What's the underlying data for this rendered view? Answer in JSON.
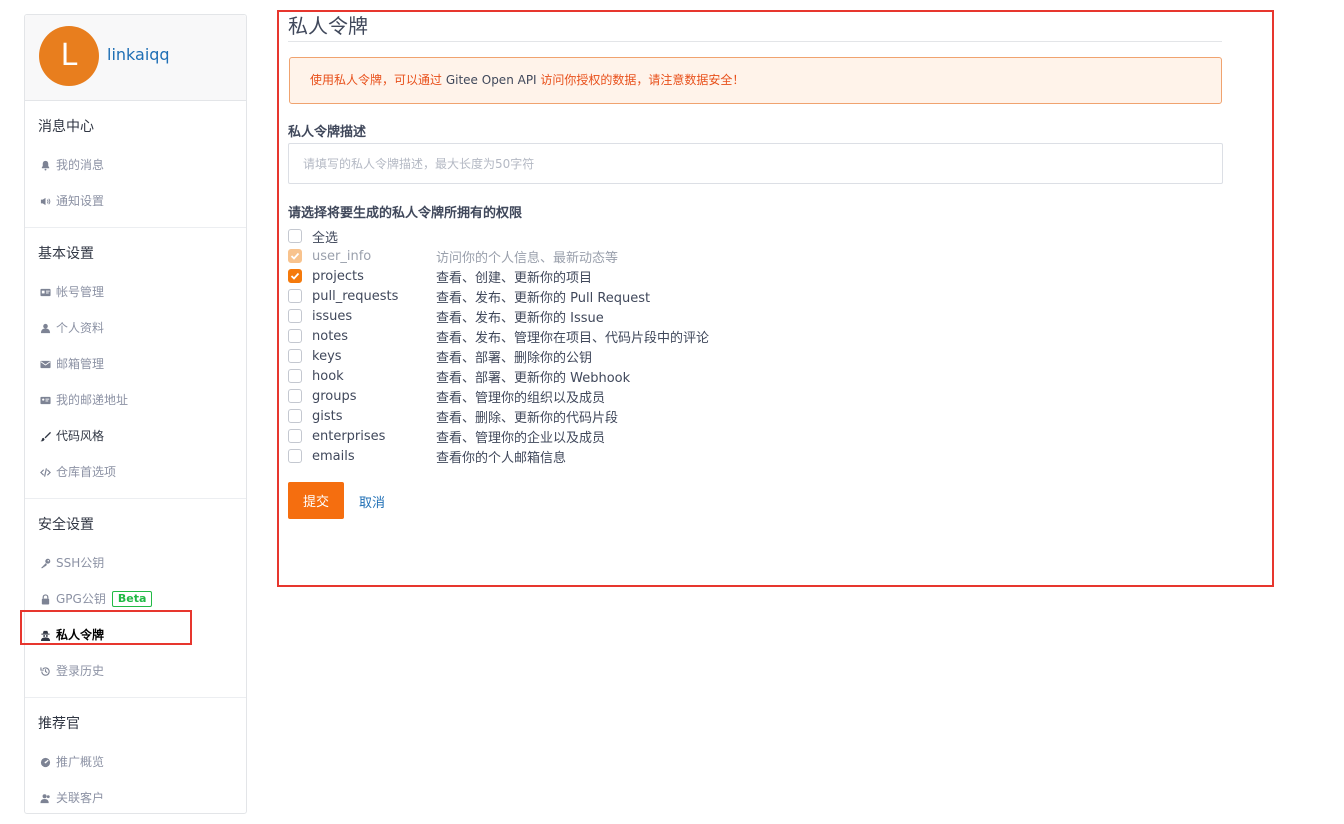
{
  "profile": {
    "avatar_letter": "L",
    "username": "linkaiqq"
  },
  "sidebar": {
    "sections": [
      {
        "title": "消息中心",
        "items": [
          {
            "label": "我的消息",
            "icon": "bell-icon"
          },
          {
            "label": "通知设置",
            "icon": "volume-icon"
          }
        ]
      },
      {
        "title": "基本设置",
        "items": [
          {
            "label": "帐号管理",
            "icon": "id-card-icon"
          },
          {
            "label": "个人资料",
            "icon": "user-icon"
          },
          {
            "label": "邮箱管理",
            "icon": "mail-icon"
          },
          {
            "label": "我的邮递地址",
            "icon": "address-card-icon"
          },
          {
            "label": "代码风格",
            "icon": "brush-icon"
          },
          {
            "label": "仓库首选项",
            "icon": "code-icon"
          }
        ]
      },
      {
        "title": "安全设置",
        "items": [
          {
            "label": "SSH公钥",
            "icon": "key-icon"
          },
          {
            "label": "GPG公钥",
            "icon": "lock-icon",
            "badge": "Beta"
          },
          {
            "label": "私人令牌",
            "icon": "user-secret-icon",
            "active": true
          },
          {
            "label": "登录历史",
            "icon": "history-icon"
          }
        ]
      },
      {
        "title": "推荐官",
        "items": [
          {
            "label": "推广概览",
            "icon": "dashboard-icon"
          },
          {
            "label": "关联客户",
            "icon": "users-icon"
          }
        ]
      }
    ]
  },
  "main": {
    "title": "私人令牌",
    "notice": {
      "prefix": "使用私人令牌，可以通过 ",
      "highlight": "Gitee Open API",
      "suffix": " 访问你授权的数据，请注意数据安全！"
    },
    "description_label": "私人令牌描述",
    "description_placeholder": "请填写的私人令牌描述，最大长度为50字符",
    "description_value": "",
    "permissions_label": "请选择将要生成的私人令牌所拥有的权限",
    "select_all_label": "全选",
    "permissions": [
      {
        "name": "user_info",
        "desc": "访问你的个人信息、最新动态等",
        "checked": true,
        "disabled": true
      },
      {
        "name": "projects",
        "desc": "查看、创建、更新你的项目",
        "checked": true,
        "disabled": false
      },
      {
        "name": "pull_requests",
        "desc": "查看、发布、更新你的 Pull Request",
        "checked": false,
        "disabled": false
      },
      {
        "name": "issues",
        "desc": "查看、发布、更新你的 Issue",
        "checked": false,
        "disabled": false
      },
      {
        "name": "notes",
        "desc": "查看、发布、管理你在项目、代码片段中的评论",
        "checked": false,
        "disabled": false
      },
      {
        "name": "keys",
        "desc": "查看、部署、删除你的公钥",
        "checked": false,
        "disabled": false
      },
      {
        "name": "hook",
        "desc": "查看、部署、更新你的 Webhook",
        "checked": false,
        "disabled": false
      },
      {
        "name": "groups",
        "desc": "查看、管理你的组织以及成员",
        "checked": false,
        "disabled": false
      },
      {
        "name": "gists",
        "desc": "查看、删除、更新你的代码片段",
        "checked": false,
        "disabled": false
      },
      {
        "name": "enterprises",
        "desc": "查看、管理你的企业以及成员",
        "checked": false,
        "disabled": false
      },
      {
        "name": "emails",
        "desc": "查看你的个人邮箱信息",
        "checked": false,
        "disabled": false
      }
    ],
    "submit_label": "提交",
    "cancel_label": "取消"
  },
  "colors": {
    "accent": "#f56e0f",
    "link": "#1f6fb5",
    "highlight_border": "#e7362e",
    "beta": "#21ba45"
  }
}
